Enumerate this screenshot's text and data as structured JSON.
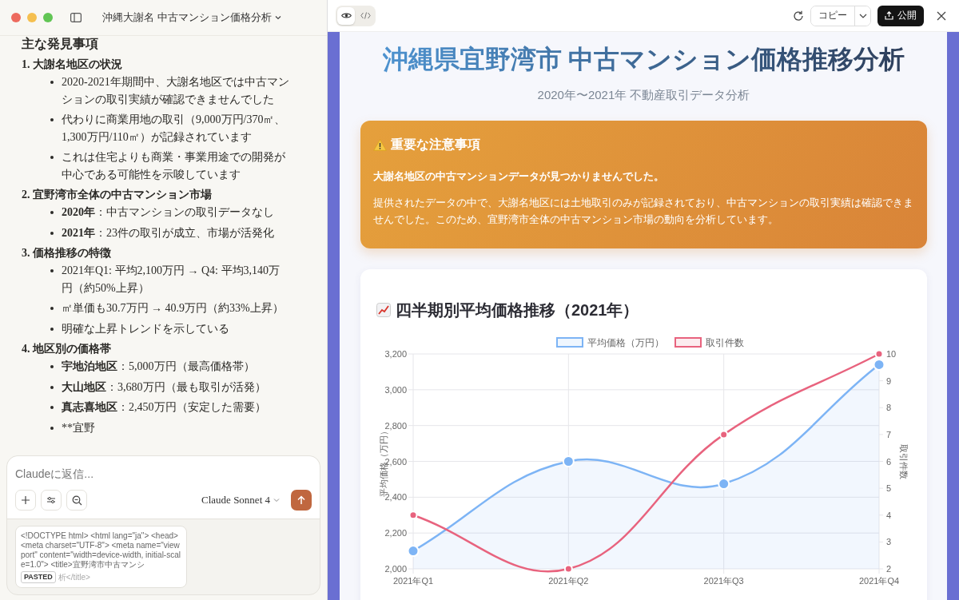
{
  "left": {
    "title": "沖縄大謝名 中古マンション価格分析",
    "heading": "主な発見事項",
    "sections": [
      {
        "title": "1. 大謝名地区の状況",
        "items": [
          "2020-2021年期間中、大謝名地区では中古マンションの取引実績が確認できませんでした",
          "代わりに商業用地の取引（9,000万円/370㎡、1,300万円/110㎡）が記録されています",
          "これは住宅よりも商業・事業用途での開発が中心である可能性を示唆しています"
        ]
      },
      {
        "title": "2. 宜野湾市全体の中古マンション市場",
        "items": [
          "**2020年**：中古マンションの取引データなし",
          "**2021年**：23件の取引が成立、市場が活発化"
        ]
      },
      {
        "title": "3. 価格推移の特徴",
        "items": [
          "2021年Q1: 平均2,100万円 → Q4: 平均3,140万円（約50%上昇）",
          "㎡単価も30.7万円 → 40.9万円（約33%上昇）",
          "明確な上昇トレンドを示している"
        ]
      },
      {
        "title": "4. 地区別の価格帯",
        "items": [
          "**宇地泊地区**：5,000万円（最高価格帯）",
          "**大山地区**：3,680万円（最も取引が活発）",
          "**真志喜地区**：2,450万円（安定した需要）",
          "**宜野"
        ]
      }
    ],
    "composer": {
      "placeholder": "Claudeに返信...",
      "model": "Claude Sonnet 4"
    },
    "attachment": {
      "preview": "<!DOCTYPE html> <html lang=\"ja\"> <head> <meta charset=\"UTF-8\"> <meta name=\"viewport\" content=\"width=device-width, initial-scale=1.0\"> <title>宜野湾市中古マンシ",
      "badge": "PASTED",
      "tail": "析</title>"
    }
  },
  "right": {
    "view_tabs": [
      {
        "kind": "preview",
        "selected": true
      },
      {
        "kind": "code",
        "selected": false
      }
    ],
    "copy_button": "コピー",
    "publish_button": "公開",
    "title": "沖縄県宜野湾市 中古マンション価格推移分析",
    "subtitle": "2020年〜2021年 不動産取引データ分析",
    "alert": {
      "title": "重要な注意事項",
      "lead": "大謝名地区の中古マンションデータが見つかりませんでした。",
      "body": "提供されたデータの中で、大謝名地区には土地取引のみが記録されており、中古マンションの取引実績は確認できませんでした。このため、宜野湾市全体の中古マンション市場の動向を分析しています。"
    },
    "chart_card": {
      "title": "四半期別平均価格推移（2021年）",
      "chart_data": {
        "type": "line",
        "categories": [
          "2021年Q1",
          "2021年Q2",
          "2021年Q3",
          "2021年Q4"
        ],
        "series": [
          {
            "name": "平均価格（万円）",
            "color": "#7db4f5",
            "values": [
              2100,
              2600,
              2475,
              3140
            ],
            "type": "area",
            "marker": "circle"
          },
          {
            "name": "取引件数",
            "color": "#e8637e",
            "values": [
              4,
              2,
              7,
              10
            ],
            "axis": "y2",
            "type": "line",
            "marker": "circle"
          }
        ],
        "grid": true,
        "legend": "top",
        "ylabel": "平均価格（万円）",
        "ylim": [
          2000,
          3200
        ],
        "yticks": [
          {
            "value": 2000,
            "label": "2,000"
          },
          {
            "value": 2200,
            "label": "2,200"
          },
          {
            "value": 2400,
            "label": "2,400"
          },
          {
            "value": 2600,
            "label": "2,600"
          },
          {
            "value": 2800,
            "label": "2,800"
          },
          {
            "value": 3000,
            "label": "3,000"
          },
          {
            "value": 3200,
            "label": "3,200"
          }
        ],
        "y2label": "取引件数",
        "y2lim": [
          2,
          10
        ],
        "y2ticks": [
          2,
          3,
          4,
          5,
          6,
          7,
          8,
          9,
          10
        ]
      }
    }
  }
}
